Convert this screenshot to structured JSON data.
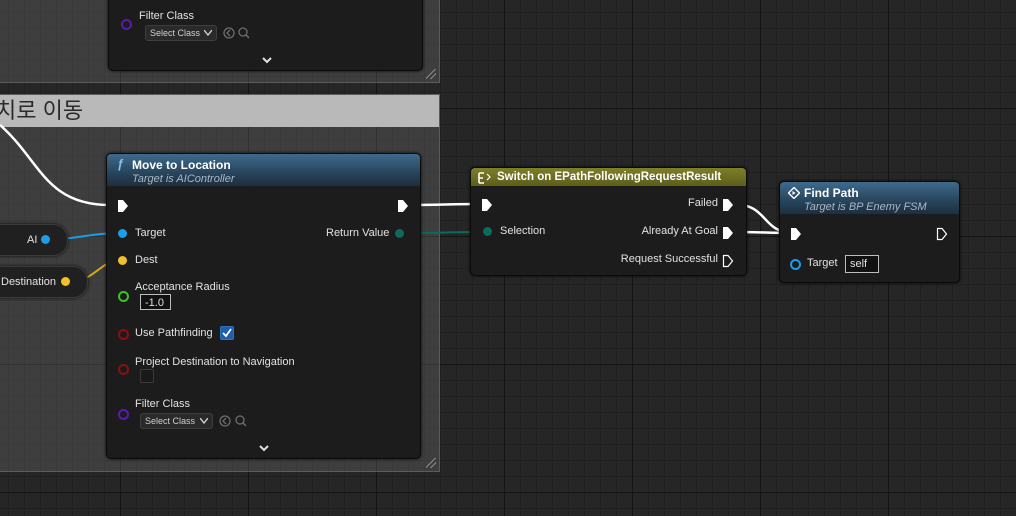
{
  "comment": {
    "title": "치로 이동"
  },
  "top_node": {
    "filter_class_label": "Filter Class",
    "select_class_label": "Select Class"
  },
  "move_to_location": {
    "title": "Move to Location",
    "subtitle": "Target is AIController",
    "function_icon": "function-icon",
    "pins": {
      "target": "Target",
      "dest": "Dest",
      "acceptance_radius": "Acceptance Radius",
      "acceptance_radius_value": "-1.0",
      "use_pathfinding": "Use Pathfinding",
      "use_pathfinding_checked": true,
      "project_destination": "Project Destination to Navigation",
      "project_destination_checked": false,
      "filter_class": "Filter Class",
      "select_class": "Select Class",
      "return_value": "Return Value"
    }
  },
  "variables": {
    "ai": "AI",
    "destination": "Destination"
  },
  "switch_node": {
    "title": "Switch on EPathFollowingRequestResult",
    "selection": "Selection",
    "failed": "Failed",
    "already_at_goal": "Already At Goal",
    "request_successful": "Request Successful"
  },
  "find_path": {
    "title": "Find Path",
    "subtitle": "Target is BP Enemy FSM",
    "target": "Target",
    "target_value": "self"
  },
  "colors": {
    "exec": "#ffffff",
    "object_pin": "#1b9ee8",
    "vector_pin": "#f1c02a",
    "float_pin": "#3fbf2a",
    "bool_pin": "#8a1010",
    "class_pin": "#5b1ba8",
    "enum_pin": "#0b6b5c",
    "header_function": "#27445b",
    "header_switch": "#6e701f"
  }
}
